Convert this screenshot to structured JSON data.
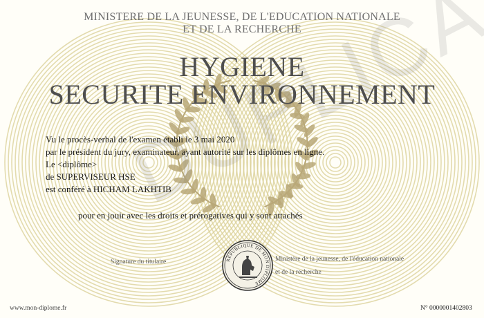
{
  "header": {
    "ministry_line1": "MINISTERE DE LA JEUNESSE, DE L'EDUCATION NATIONALE",
    "ministry_line2": "ET DE LA RECHERCHE"
  },
  "title": {
    "line1": "HYGIENE",
    "line2": "SECURITE ENVIRONNEMENT"
  },
  "body": {
    "line1": "Vu le procès-verbal de l'examen établi le 3 mai 2020",
    "line2": "par le président du jury, examinateur, ayant autorité sur les diplômes en ligne.",
    "line3": "Le <diplôme>",
    "line4": "de SUPERVISEUR HSE",
    "line5": "est conféré à HICHAM LAKHTIB",
    "line6": "pour en jouir avec les droits et prérogatives qui y sont attachés"
  },
  "footer": {
    "signature_label": "Signature du titulaire",
    "authority_line1": "Ministère de la jeunesse, de l'éducation nationale",
    "authority_line2": "et de la recherche",
    "website": "www.mon-diplome.fr",
    "number": "N° 0000001402803"
  },
  "seal": {
    "text": "REPUBLIQUE DE MON DIPLOME"
  },
  "watermark": {
    "text": "DUPLICA"
  },
  "colors": {
    "guilloche": "#d9cf95",
    "laurel": "#b8a878",
    "title": "#4e4e4e"
  }
}
